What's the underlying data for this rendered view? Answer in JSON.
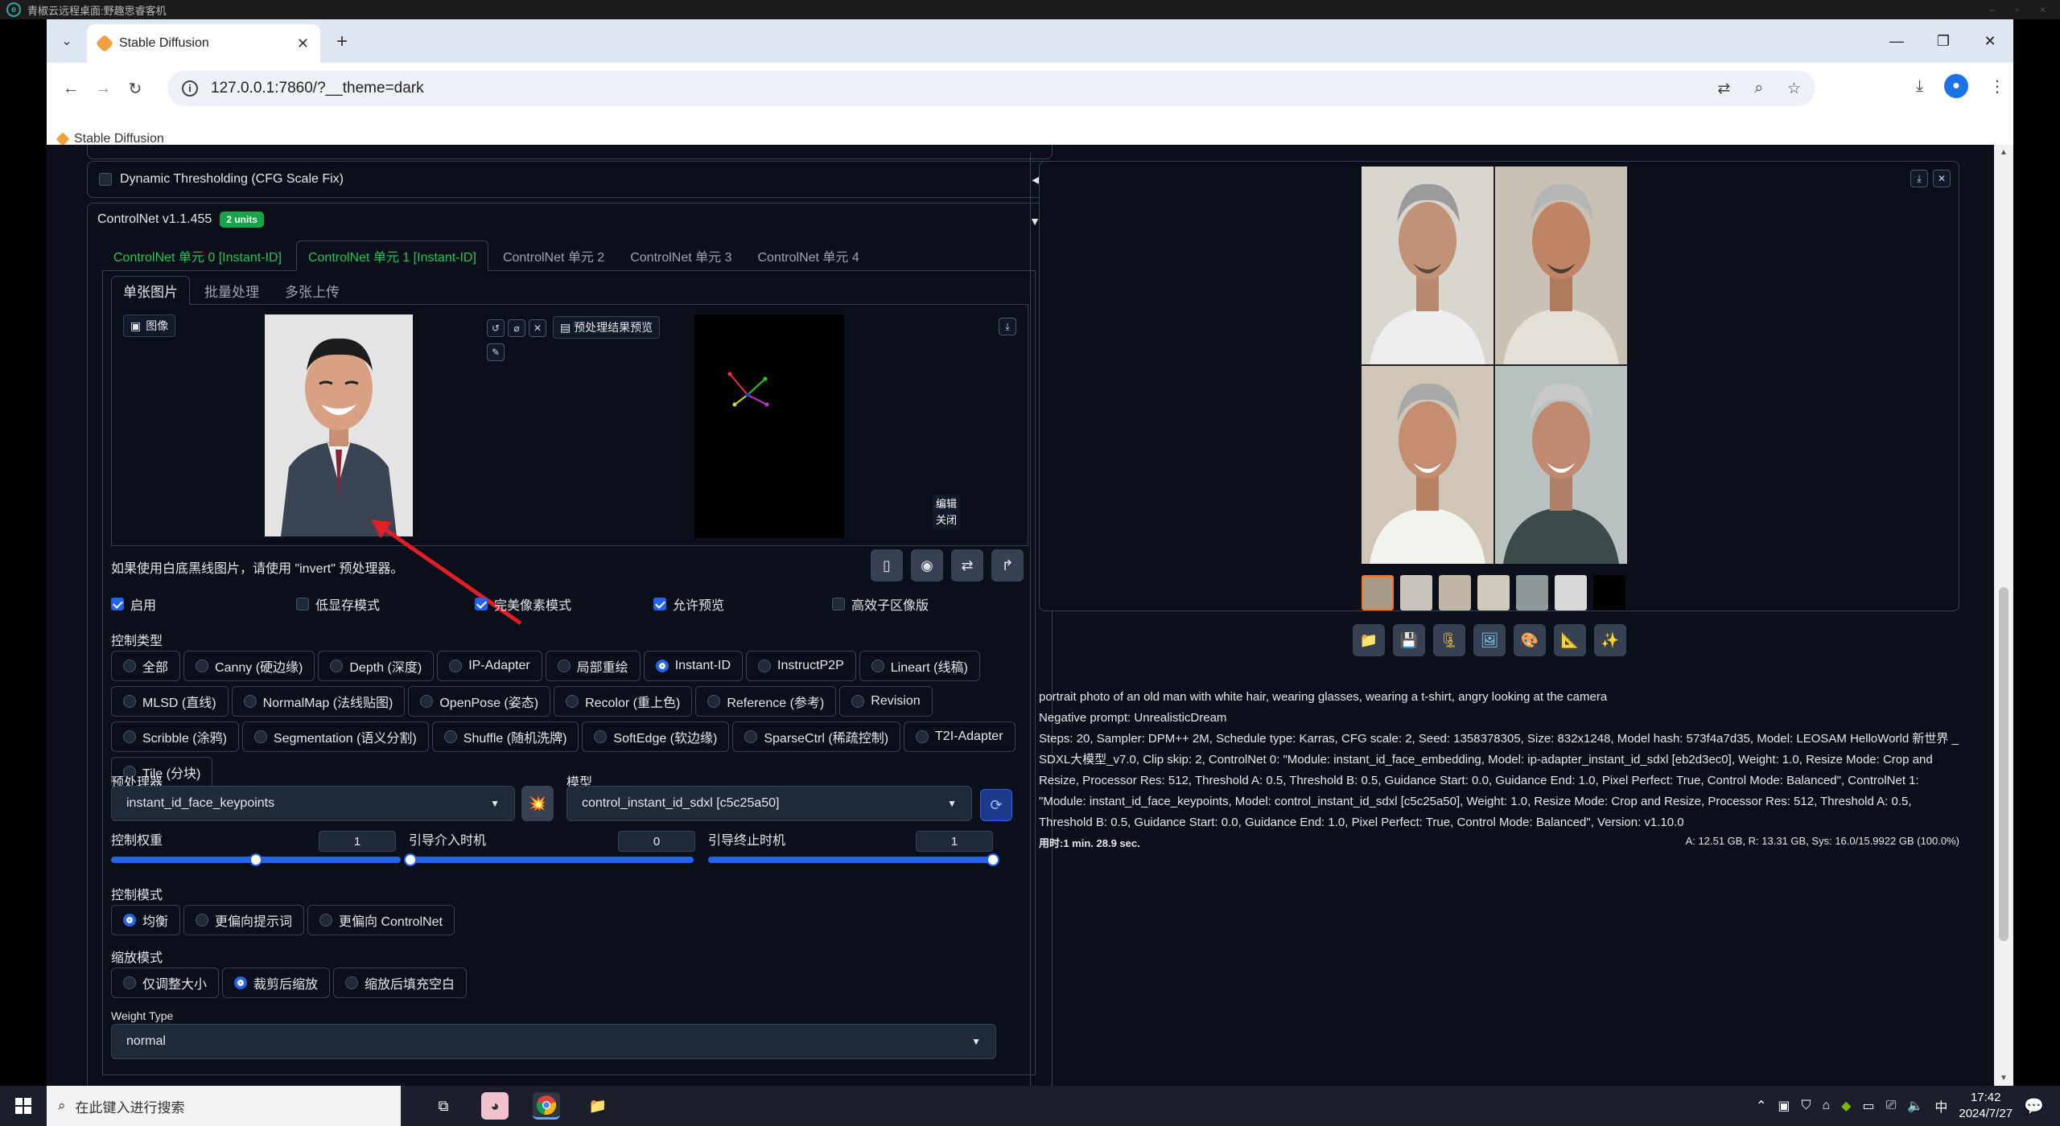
{
  "remote": {
    "title": "青椒云远程桌面:野趣思睿客机"
  },
  "browser": {
    "tab_title": "Stable Diffusion",
    "url": "127.0.0.1:7860/?__theme=dark",
    "bookmark": "Stable Diffusion"
  },
  "accordions": {
    "dynamic_thresholding": "Dynamic Thresholding (CFG Scale Fix)",
    "controlnet_title": "ControlNet v1.1.455",
    "controlnet_badge": "2 units"
  },
  "controlnet_tabs": [
    {
      "label": "ControlNet 单元 0 [Instant-ID]"
    },
    {
      "label": "ControlNet 单元 1 [Instant-ID]"
    },
    {
      "label": "ControlNet 单元 2"
    },
    {
      "label": "ControlNet 单元 3"
    },
    {
      "label": "ControlNet 单元 4"
    }
  ],
  "image_tabs": [
    "单张图片",
    "批量处理",
    "多张上传"
  ],
  "image_label": "图像",
  "preview_button": "预处理结果预览",
  "edit_label": "编辑",
  "close_label": "关闭",
  "hint": "如果使用白底黑线图片，请使用 \"invert\" 预处理器。",
  "checks": [
    {
      "label": "启用",
      "checked": true
    },
    {
      "label": "低显存模式",
      "checked": false
    },
    {
      "label": "完美像素模式",
      "checked": true
    },
    {
      "label": "允许预览",
      "checked": true
    },
    {
      "label": "高效子区像版",
      "checked": false
    }
  ],
  "control_type_label": "控制类型",
  "control_types": [
    [
      "全部",
      "Canny (硬边缘)",
      "Depth (深度)",
      "IP-Adapter",
      "局部重绘",
      "Instant-ID",
      "InstructP2P",
      "Lineart (线稿)"
    ],
    [
      "MLSD (直线)",
      "NormalMap (法线贴图)",
      "OpenPose (姿态)",
      "Recolor (重上色)",
      "Reference (参考)",
      "Revision"
    ],
    [
      "Scribble (涂鸦)",
      "Segmentation (语义分割)",
      "Shuffle (随机洗牌)",
      "SoftEdge (软边缘)",
      "SparseCtrl (稀疏控制)",
      "T2I-Adapter"
    ],
    [
      "Tile (分块)"
    ]
  ],
  "control_type_selected": "Instant-ID",
  "preprocessor_label": "预处理器",
  "preprocessor_value": "instant_id_face_keypoints",
  "model_label": "模型",
  "model_value": "control_instant_id_sdxl [c5c25a50]",
  "sliders": [
    {
      "label": "控制权重",
      "value": "1",
      "fraction": 0.5
    },
    {
      "label": "引导介入时机",
      "value": "0",
      "fraction": 0.0
    },
    {
      "label": "引导终止时机",
      "value": "1",
      "fraction": 1.0
    }
  ],
  "control_mode_label": "控制模式",
  "control_modes": [
    "均衡",
    "更偏向提示词",
    "更偏向 ControlNet"
  ],
  "resize_mode_label": "缩放模式",
  "resize_modes": [
    "仅调整大小",
    "裁剪后缩放",
    "缩放后填充空白"
  ],
  "weight_type_label": "Weight Type",
  "weight_type_value": "normal",
  "output": {
    "prompt": "portrait photo of an old man with white hair, wearing glasses, wearing a t-shirt, angry looking at the camera",
    "negative": "Negative prompt: UnrealisticDream",
    "params": "Steps: 20, Sampler: DPM++ 2M, Schedule type: Karras, CFG scale: 2, Seed: 1358378305, Size: 832x1248, Model hash: 573f4a7d35, Model: LEOSAM HelloWorld 新世界 _ SDXL大模型_v7.0, Clip skip: 2, ControlNet 0: \"Module: instant_id_face_embedding, Model: ip-adapter_instant_id_sdxl [eb2d3ec0], Weight: 1.0, Resize Mode: Crop and Resize, Processor Res: 512, Threshold A: 0.5, Threshold B: 0.5, Guidance Start: 0.0, Guidance End: 1.0, Pixel Perfect: True, Control Mode: Balanced\", ControlNet 1: \"Module: instant_id_face_keypoints, Model: control_instant_id_sdxl [c5c25a50], Weight: 1.0, Resize Mode: Crop and Resize, Processor Res: 512, Threshold A: 0.5, Threshold B: 0.5, Guidance Start: 0.0, Guidance End: 1.0, Pixel Perfect: True, Control Mode: Balanced\", Version: v1.10.0",
    "time": "用时:1 min. 28.9 sec.",
    "memory": "A: 12.51 GB, R: 13.31 GB, Sys: 16.0/15.9922 GB (100.0%)"
  },
  "taskbar": {
    "search_placeholder": "在此键入进行搜索",
    "ime": "中",
    "time": "17:42",
    "date": "2024/7/27"
  }
}
